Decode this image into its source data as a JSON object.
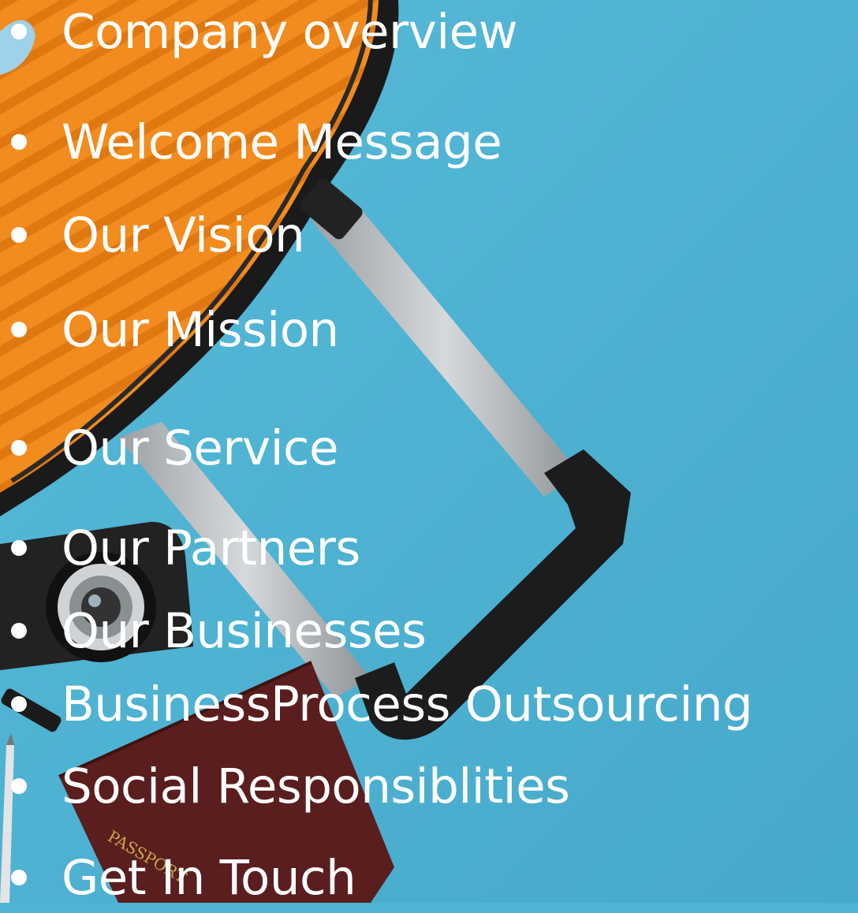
{
  "toc": {
    "items": [
      {
        "label": "Company overview"
      },
      {
        "label": "Welcome Message"
      },
      {
        "label": "Our Vision"
      },
      {
        "label": "Our Mission"
      },
      {
        "label": "Our Service"
      },
      {
        "label": "Our Partners"
      },
      {
        "label": "Our Businesses"
      },
      {
        "label": "BusinessProcess Outsourcing"
      },
      {
        "label": "Social Responsiblities"
      },
      {
        "label": "Get In Touch"
      }
    ]
  },
  "photo": {
    "passport_text": "PASSPORT"
  },
  "colors": {
    "background": "#4fb3d3",
    "suitcase": "#f28c1e",
    "text": "#ffffff",
    "passport": "#5a1e1e"
  }
}
